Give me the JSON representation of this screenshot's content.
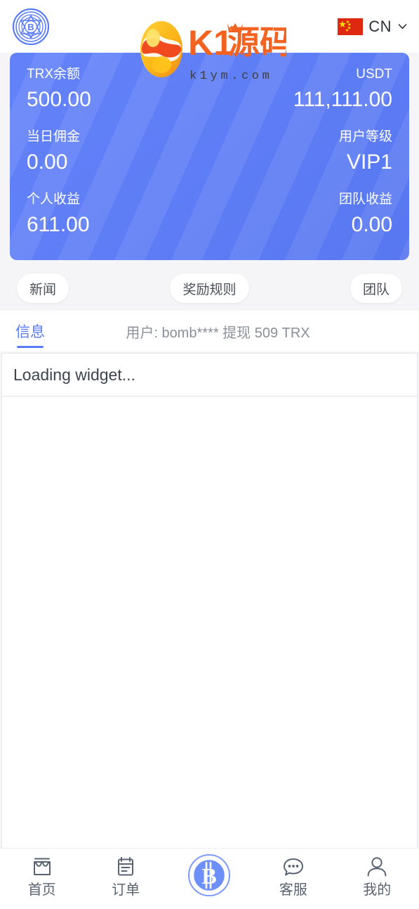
{
  "header": {
    "logo_icon": "brand-circle-b-logo",
    "language": {
      "flag_icon": "china-flag-icon",
      "code": "CN",
      "chevron_icon": "chevron-down-icon"
    }
  },
  "watermark": {
    "title": "K1源码",
    "domain": "k1ym.com",
    "mark_icon": "k1-yinyang-egg-logo"
  },
  "balance_card": {
    "accent_color": "#5b7cfa",
    "rows": [
      {
        "left_label": "TRX余额",
        "left_value": "500.00",
        "right_label": "USDT",
        "right_value": "111,111.00"
      },
      {
        "left_label": "当日佣金",
        "left_value": "0.00",
        "right_label": "用户等级",
        "right_value": "VIP1"
      },
      {
        "left_label": "个人收益",
        "left_value": "611.00",
        "right_label": "团队收益",
        "right_value": "0.00"
      }
    ]
  },
  "pills": [
    {
      "label": "新闻"
    },
    {
      "label": "奖励规则"
    },
    {
      "label": "团队"
    }
  ],
  "notice": {
    "tab_label": "信息",
    "message": "用户: bomb**** 提现 509 TRX"
  },
  "content": {
    "loading_text": "Loading widget..."
  },
  "bottom_nav": {
    "items": [
      {
        "label": "首页",
        "icon": "shop-icon"
      },
      {
        "label": "订单",
        "icon": "clipboard-icon"
      },
      {
        "label": "",
        "icon": "bitcoin-coin-icon"
      },
      {
        "label": "客服",
        "icon": "chat-bubble-dots-icon"
      },
      {
        "label": "我的",
        "icon": "person-icon"
      }
    ]
  }
}
